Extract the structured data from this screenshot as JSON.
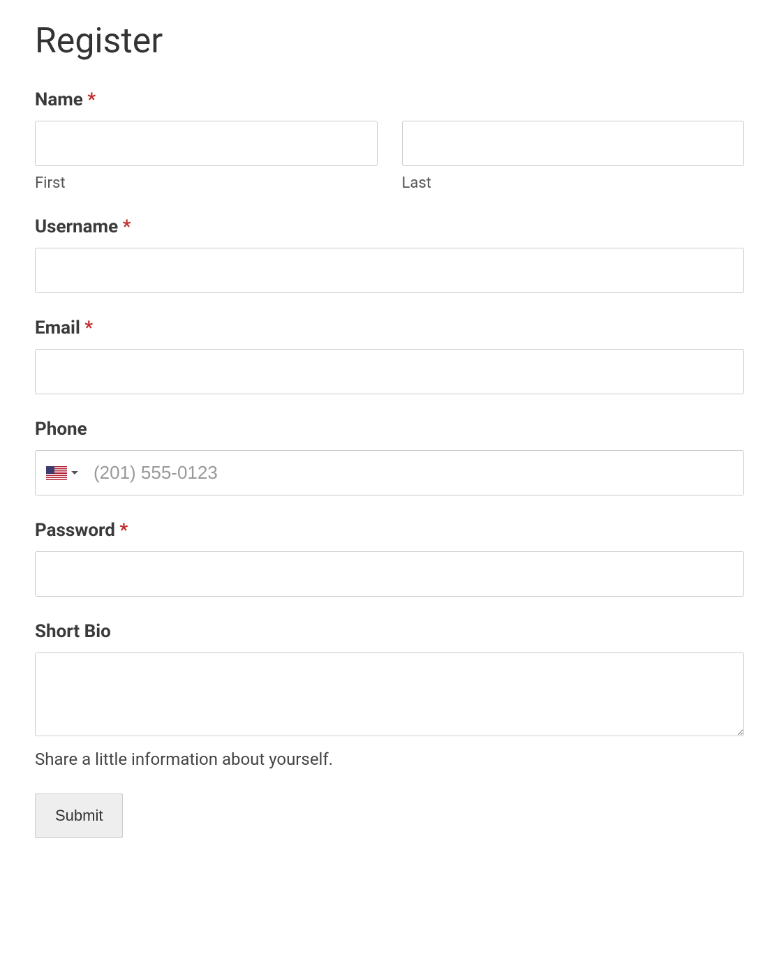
{
  "page": {
    "title": "Register"
  },
  "fields": {
    "name": {
      "label": "Name",
      "required_mark": "*",
      "first_sublabel": "First",
      "last_sublabel": "Last",
      "first_value": "",
      "last_value": ""
    },
    "username": {
      "label": "Username",
      "required_mark": "*",
      "value": ""
    },
    "email": {
      "label": "Email",
      "required_mark": "*",
      "value": ""
    },
    "phone": {
      "label": "Phone",
      "placeholder": "(201) 555-0123",
      "value": "",
      "country_flag": "us"
    },
    "password": {
      "label": "Password",
      "required_mark": "*",
      "value": ""
    },
    "bio": {
      "label": "Short Bio",
      "value": "",
      "helper": "Share a little information about yourself."
    }
  },
  "actions": {
    "submit_label": "Submit"
  }
}
